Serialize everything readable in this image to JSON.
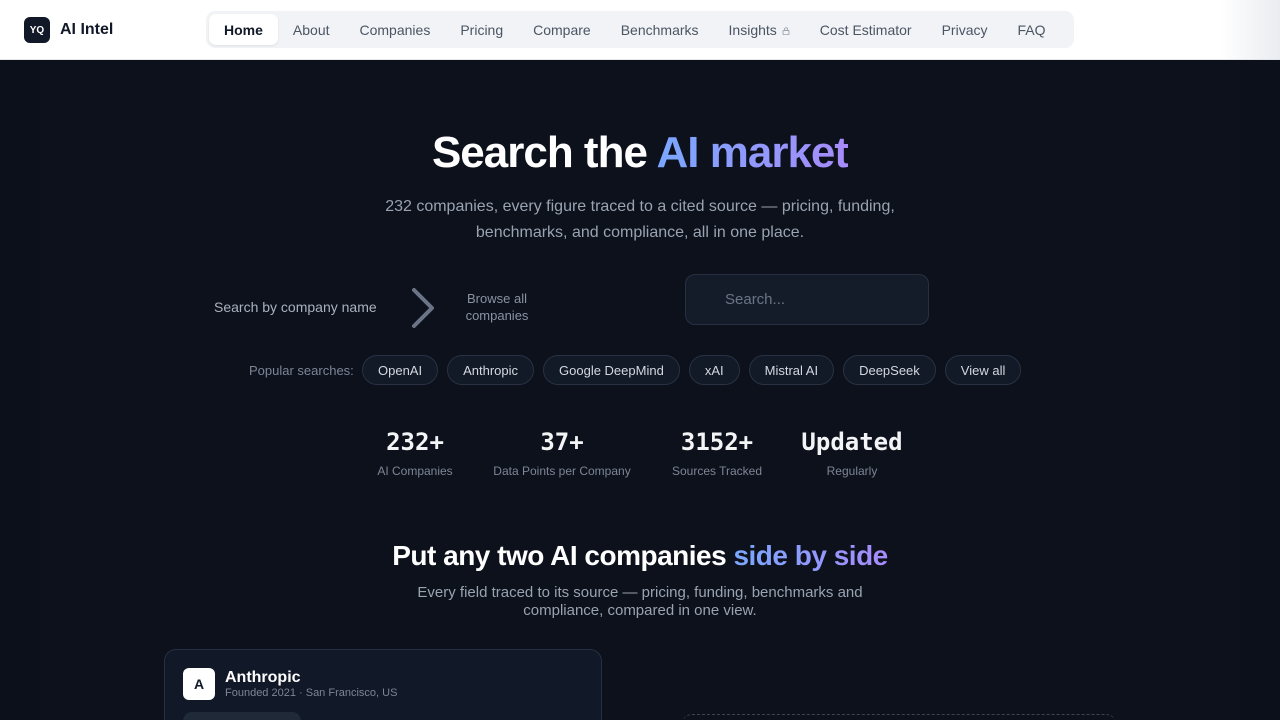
{
  "brand": {
    "badge": "YQ",
    "name": "AI Intel"
  },
  "nav": {
    "items": [
      {
        "label": "Home",
        "active": true
      },
      {
        "label": "About"
      },
      {
        "label": "Companies"
      },
      {
        "label": "Pricing"
      },
      {
        "label": "Compare"
      },
      {
        "label": "Benchmarks"
      },
      {
        "label": "Insights",
        "icon": "lock-icon"
      },
      {
        "label": "Cost Estimator"
      },
      {
        "label": "Privacy"
      },
      {
        "label": "FAQ"
      }
    ]
  },
  "hero": {
    "title_prefix": "Search the ",
    "title_accent": "AI market",
    "subtitle": "232 companies, every figure traced to a cited source — pricing, funding, benchmarks, and compliance, all in one place."
  },
  "search": {
    "label": "Search by company name",
    "browse_label": "Browse all companies",
    "placeholder": "Search..."
  },
  "popular": {
    "label": "Popular searches:",
    "chips": [
      "OpenAI",
      "Anthropic",
      "Google DeepMind",
      "xAI",
      "Mistral AI",
      "DeepSeek",
      "View all"
    ]
  },
  "stats": [
    {
      "value": "232+",
      "label": "AI Companies"
    },
    {
      "value": "37+",
      "label": "Data Points per Company"
    },
    {
      "value": "3152+",
      "label": "Sources Tracked"
    },
    {
      "value": "Updated",
      "label": "Regularly"
    }
  ],
  "compare_section": {
    "title_prefix": "Put any two AI companies ",
    "title_accent": "side by side",
    "subtitle": "Every field traced to its source — pricing, funding, benchmarks and compliance, compared in one view."
  },
  "company_card": {
    "avatar": "A",
    "name": "Anthropic",
    "meta": "Founded 2021 · San Francisco, US"
  },
  "colors": {
    "background": "#0b101a",
    "accent_start": "#7aa7ff",
    "accent_end": "#a78bfa"
  }
}
